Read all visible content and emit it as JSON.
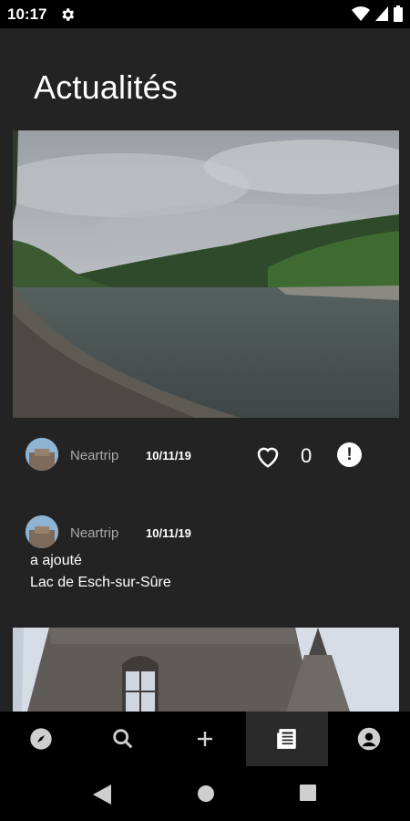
{
  "status_bar": {
    "time": "10:17",
    "icons": [
      "settings-icon",
      "wifi-icon",
      "signal-icon",
      "battery-icon"
    ]
  },
  "page": {
    "title": "Actualités"
  },
  "feed": {
    "post": {
      "author": "Neartrip",
      "date": "10/11/19",
      "likes": "0",
      "like_icon": "heart-outline-icon",
      "report_icon": "exclamation-icon",
      "report_glyph": "!"
    },
    "activity": {
      "author": "Neartrip",
      "date": "10/11/19",
      "action": "a ajouté",
      "place": "Lac de Esch-sur-Sûre"
    }
  },
  "bottom_nav": {
    "items": [
      {
        "icon": "compass-icon",
        "active": false
      },
      {
        "icon": "search-icon",
        "active": false
      },
      {
        "icon": "plus-icon",
        "active": false
      },
      {
        "icon": "news-icon",
        "active": true
      },
      {
        "icon": "profile-icon",
        "active": false
      }
    ]
  },
  "colors": {
    "background": "#232323",
    "bar": "#000000",
    "muted_text": "#a9a9a9",
    "icon": "#cfcfcf"
  }
}
